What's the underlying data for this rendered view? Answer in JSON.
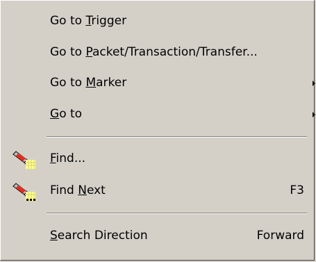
{
  "menu": {
    "items": [
      {
        "pre": "Go to ",
        "ul": "T",
        "post": "rigger",
        "shortcut": "",
        "submenu": false
      },
      {
        "pre": "Go to ",
        "ul": "P",
        "post": "acket/Transaction/Transfer...",
        "shortcut": "",
        "submenu": false
      },
      {
        "pre": "Go to ",
        "ul": "M",
        "post": "arker",
        "shortcut": "",
        "submenu": true
      },
      {
        "pre": "",
        "ul": "G",
        "post": "o to",
        "shortcut": "",
        "submenu": true
      },
      {
        "pre": "",
        "ul": "F",
        "post": "ind...",
        "shortcut": "",
        "submenu": false,
        "icon": "find-flashlight-icon"
      },
      {
        "pre": "Find ",
        "ul": "N",
        "post": "ext",
        "shortcut": "F3",
        "submenu": false,
        "icon": "find-next-flashlight-icon"
      },
      {
        "pre": "",
        "ul": "S",
        "post": "earch Direction",
        "shortcut": "Forward",
        "submenu": false
      }
    ]
  },
  "colors": {
    "menu_background": "#d4d0c8",
    "icon_yellow": "#ffff99",
    "icon_red": "#e03020"
  }
}
